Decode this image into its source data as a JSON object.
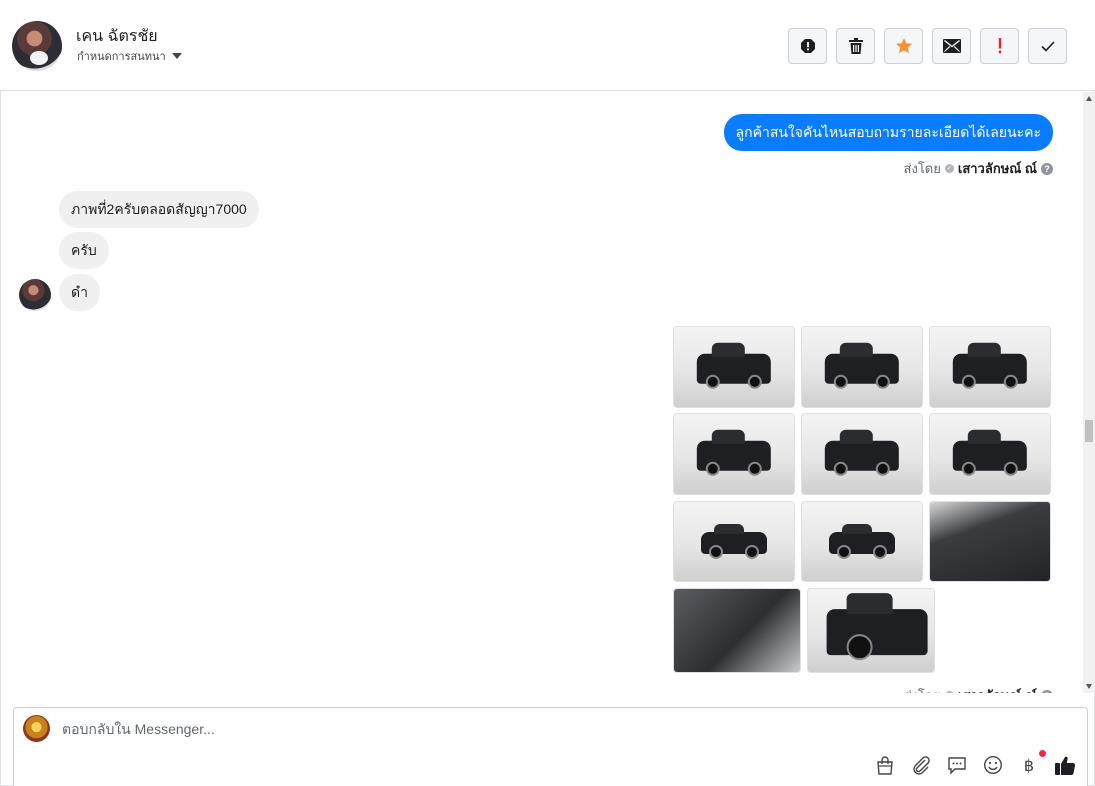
{
  "header": {
    "name": "เคน ฉัตรชัย",
    "assign_label": "กำหนดการสนทนา"
  },
  "toolbar": {
    "buttons": [
      {
        "icon": "spam-alert-icon"
      },
      {
        "icon": "trash-icon"
      },
      {
        "icon": "star-icon",
        "color": "#f7923a"
      },
      {
        "icon": "mail-icon"
      },
      {
        "icon": "follow-up-icon",
        "color": "#e41e3f"
      },
      {
        "icon": "checkmark-icon"
      }
    ]
  },
  "messages": {
    "outgoing_1": "ลูกค้าสนใจคันไหนสอบถามรายละเอียดได้เลยนะคะ",
    "sent_by_prefix": "ส่งโดย",
    "sent_by_name": "เสาวลักษณ์ ณ์",
    "incoming": [
      "ภาพที่2ครับตลอดสัญญา7000",
      "ครับ",
      "ดำ"
    ],
    "photo_count": 11,
    "help_mark": "?"
  },
  "composer": {
    "placeholder": "ตอบกลับใน Messenger...",
    "tools": [
      "shopping-bag-icon",
      "paperclip-icon",
      "saved-replies-icon",
      "emoji-icon",
      "baht-payment-icon",
      "thumbs-up-icon"
    ],
    "baht_symbol": "฿"
  },
  "colors": {
    "outgoing_bubble": "#0a7cff",
    "incoming_bubble": "#f0f0f0"
  }
}
